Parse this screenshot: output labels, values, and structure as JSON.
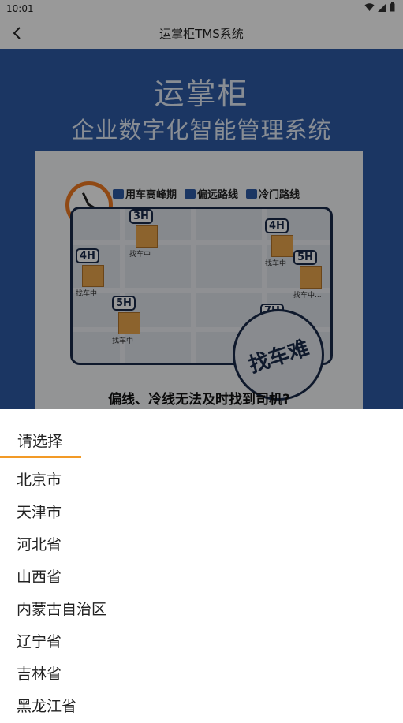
{
  "status_bar": {
    "time": "10:01"
  },
  "app_bar": {
    "title": "运掌柜TMS系统"
  },
  "banner": {
    "brand": "运掌柜",
    "subtitle": "企业数字化智能管理系统",
    "tags": [
      "用车高峰期",
      "偏远路线",
      "冷门路线"
    ],
    "markers": [
      {
        "hours": "3H",
        "label": "找车中"
      },
      {
        "hours": "4H",
        "label": "找车中"
      },
      {
        "hours": "4H",
        "label": "找车中"
      },
      {
        "hours": "5H",
        "label": "找车中"
      },
      {
        "hours": "5H",
        "label": "找车中..."
      },
      {
        "hours": "7H",
        "label": ""
      }
    ],
    "stamp": "找车难",
    "caption": "偏线、冷线无法及时找到司机?"
  },
  "sheet": {
    "tab_label": "请选择",
    "accent_color": "#f29a26",
    "provinces": [
      "北京市",
      "天津市",
      "河北省",
      "山西省",
      "内蒙古自治区",
      "辽宁省",
      "吉林省",
      "黑龙江省"
    ]
  }
}
